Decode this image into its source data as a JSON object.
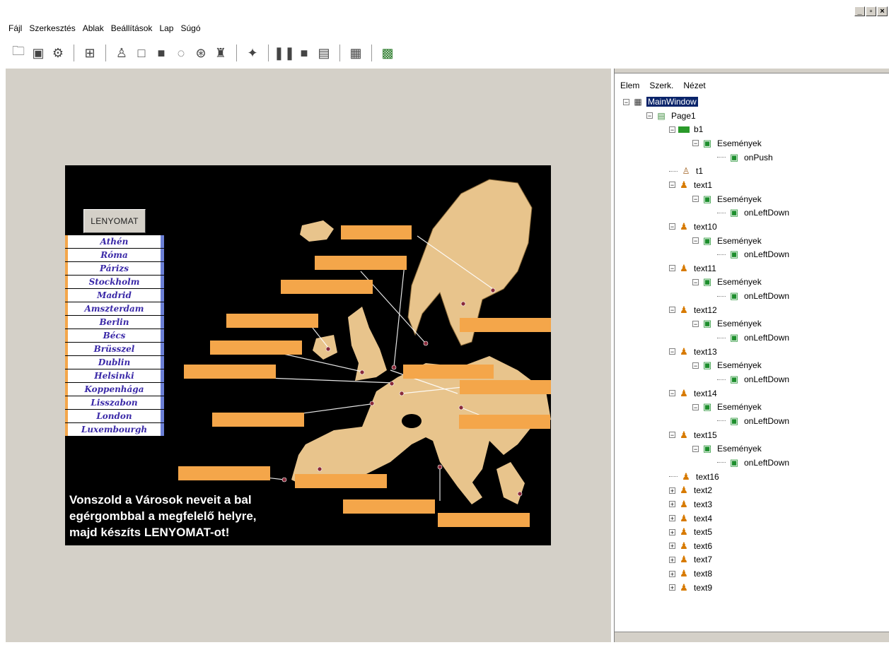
{
  "window": {
    "buttons": [
      "_",
      "▫",
      "×"
    ]
  },
  "menu": [
    "Fájl",
    "Szerkesztés",
    "Ablak",
    "Beállítások",
    "Lap",
    "Súgó"
  ],
  "toolbar_icons": [
    "open-icon",
    "save-icon",
    "print-icon",
    "align-icon",
    "figure-icon",
    "rect-icon",
    "filled-rect-icon",
    "ellipse-icon",
    "media-icon",
    "text-icon",
    "wizard-icon",
    "pause-icon",
    "stop-icon",
    "run-icon",
    "preview-icon",
    "page-icon"
  ],
  "canvas": {
    "button_label": "LENYOMAT",
    "cities": [
      "Athén",
      "Róma",
      "Párizs",
      "Stockholm",
      "Madrid",
      "Amszterdam",
      "Berlin",
      "Bécs",
      "Brüsszel",
      "Dublin",
      "Helsinki",
      "Koppenhága",
      "Lisszabon",
      "London",
      "Luxembourgh"
    ],
    "instruction": [
      "Vonszold a Városok neveit a bal",
      "egérgombbal a megfelelő helyre,",
      "majd készíts LENYOMAT-ot!"
    ],
    "colors": {
      "slot": "#f4a64a",
      "land": "#e8c48c",
      "sea": "#000000",
      "city_text": "#3b2aa8"
    }
  },
  "panel": {
    "menu": [
      "Elem",
      "Szerk.",
      "Nézet"
    ],
    "tree": [
      {
        "label": "MainWindow",
        "level": 0,
        "exp": "−",
        "icon": "main",
        "selected": true
      },
      {
        "label": "Page1",
        "level": 1,
        "exp": "−",
        "icon": "page"
      },
      {
        "label": "b1",
        "level": 2,
        "exp": "−",
        "icon": "green"
      },
      {
        "label": "Események",
        "level": 3,
        "exp": "−",
        "icon": "ev"
      },
      {
        "label": "onPush",
        "level": 4,
        "exp": "",
        "icon": "ev"
      },
      {
        "label": "t1",
        "level": 2,
        "exp": "",
        "icon": "person"
      },
      {
        "label": "text1",
        "level": 2,
        "exp": "−",
        "icon": "t"
      },
      {
        "label": "Események",
        "level": 3,
        "exp": "−",
        "icon": "ev"
      },
      {
        "label": "onLeftDown",
        "level": 4,
        "exp": "",
        "icon": "ev"
      },
      {
        "label": "text10",
        "level": 2,
        "exp": "−",
        "icon": "t"
      },
      {
        "label": "Események",
        "level": 3,
        "exp": "−",
        "icon": "ev"
      },
      {
        "label": "onLeftDown",
        "level": 4,
        "exp": "",
        "icon": "ev"
      },
      {
        "label": "text11",
        "level": 2,
        "exp": "−",
        "icon": "t"
      },
      {
        "label": "Események",
        "level": 3,
        "exp": "−",
        "icon": "ev"
      },
      {
        "label": "onLeftDown",
        "level": 4,
        "exp": "",
        "icon": "ev"
      },
      {
        "label": "text12",
        "level": 2,
        "exp": "−",
        "icon": "t"
      },
      {
        "label": "Események",
        "level": 3,
        "exp": "−",
        "icon": "ev"
      },
      {
        "label": "onLeftDown",
        "level": 4,
        "exp": "",
        "icon": "ev"
      },
      {
        "label": "text13",
        "level": 2,
        "exp": "−",
        "icon": "t"
      },
      {
        "label": "Események",
        "level": 3,
        "exp": "−",
        "icon": "ev"
      },
      {
        "label": "onLeftDown",
        "level": 4,
        "exp": "",
        "icon": "ev"
      },
      {
        "label": "text14",
        "level": 2,
        "exp": "−",
        "icon": "t"
      },
      {
        "label": "Események",
        "level": 3,
        "exp": "−",
        "icon": "ev"
      },
      {
        "label": "onLeftDown",
        "level": 4,
        "exp": "",
        "icon": "ev"
      },
      {
        "label": "text15",
        "level": 2,
        "exp": "−",
        "icon": "t"
      },
      {
        "label": "Események",
        "level": 3,
        "exp": "−",
        "icon": "ev"
      },
      {
        "label": "onLeftDown",
        "level": 4,
        "exp": "",
        "icon": "ev"
      },
      {
        "label": "text16",
        "level": 2,
        "exp": "",
        "icon": "t"
      },
      {
        "label": "text2",
        "level": 2,
        "exp": "+",
        "icon": "t"
      },
      {
        "label": "text3",
        "level": 2,
        "exp": "+",
        "icon": "t"
      },
      {
        "label": "text4",
        "level": 2,
        "exp": "+",
        "icon": "t"
      },
      {
        "label": "text5",
        "level": 2,
        "exp": "+",
        "icon": "t"
      },
      {
        "label": "text6",
        "level": 2,
        "exp": "+",
        "icon": "t"
      },
      {
        "label": "text7",
        "level": 2,
        "exp": "+",
        "icon": "t"
      },
      {
        "label": "text8",
        "level": 2,
        "exp": "+",
        "icon": "t"
      },
      {
        "label": "text9",
        "level": 2,
        "exp": "+",
        "icon": "t"
      }
    ]
  }
}
